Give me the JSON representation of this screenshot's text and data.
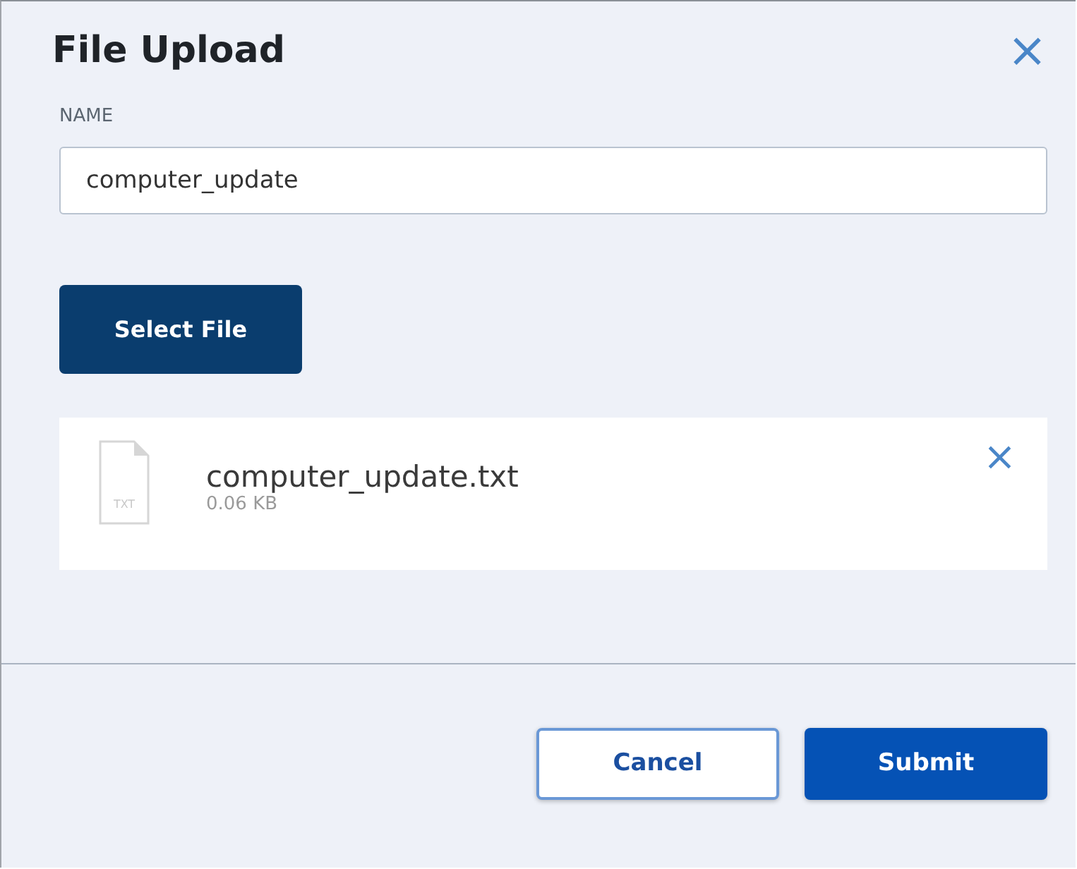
{
  "dialog": {
    "title": "File Upload",
    "close": "×"
  },
  "name_field": {
    "label": "NAME",
    "value": "computer_update"
  },
  "select_button": "Select File",
  "files": [
    {
      "icon_label": "TXT",
      "name": "computer_update.txt",
      "size": "0.06 KB",
      "remove": "×"
    }
  ],
  "buttons": [
    {
      "label": "Cancel",
      "kind": "secondary"
    },
    {
      "label": "Submit",
      "kind": "primary"
    }
  ]
}
